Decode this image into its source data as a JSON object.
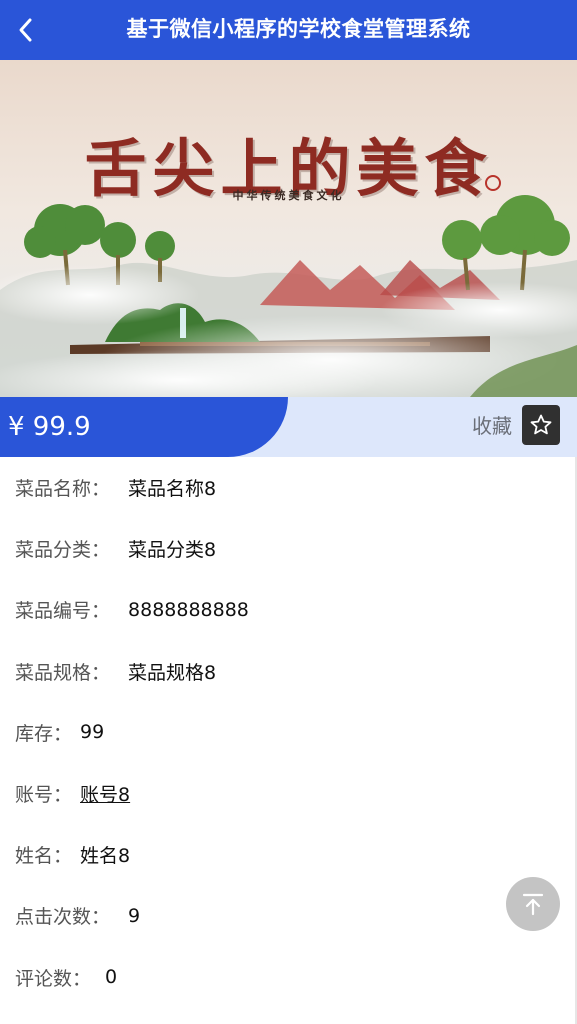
{
  "header": {
    "title": "基于微信小程序的学校食堂管理系统",
    "back_icon": "chevron-left-icon",
    "background": "#2a55d8"
  },
  "banner": {
    "slogan": "舌尖上的美食",
    "subtitle": "中华传统美食文化"
  },
  "price_bar": {
    "price": "¥ 99.9",
    "favorite_label": "收藏",
    "favorite_icon": "star-icon"
  },
  "details": [
    {
      "label": "菜品名称：",
      "value": "菜品名称8"
    },
    {
      "label": "菜品分类：",
      "value": "菜品分类8"
    },
    {
      "label": "菜品编号：",
      "value": "8888888888"
    },
    {
      "label": "菜品规格：",
      "value": "菜品规格8"
    },
    {
      "label": "库存：",
      "value": "99"
    },
    {
      "label": "账号：",
      "value": "账号8"
    },
    {
      "label": "姓名：",
      "value": "姓名8"
    },
    {
      "label": "点击次数：",
      "value": "9"
    },
    {
      "label": "评论数：",
      "value": "0"
    }
  ],
  "scroll_top_icon": "arrow-up-to-top-icon"
}
